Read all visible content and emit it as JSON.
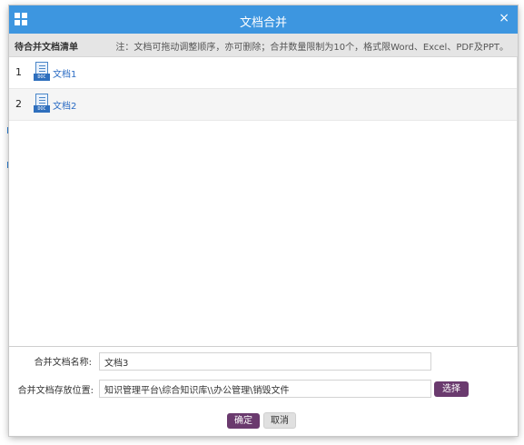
{
  "dialog": {
    "title": "文档合并",
    "close_symbol": "×"
  },
  "list": {
    "title": "待合并文档清单",
    "note": "注：文档可拖动调整顺序，亦可删除；合并数量限制为10个，格式限Word、Excel、PDF及PPT。",
    "rows": [
      {
        "index": "1",
        "name": "文档1",
        "icon": "doc-file-icon",
        "icon_tag": "DOC"
      },
      {
        "index": "2",
        "name": "文档2",
        "icon": "doc-file-icon",
        "icon_tag": "DOC"
      }
    ]
  },
  "form": {
    "name_label": "合并文档名称:",
    "name_value": "文档3",
    "location_label": "合并文档存放位置:",
    "location_value": "知识管理平台\\综合知识库\\\\办公管理\\销毁文件",
    "select_button": "选择"
  },
  "actions": {
    "confirm": "确定",
    "cancel": "取消"
  },
  "colors": {
    "titlebar": "#3d96e0",
    "primary_button": "#6a3a6e",
    "link": "#2b6cc4"
  }
}
